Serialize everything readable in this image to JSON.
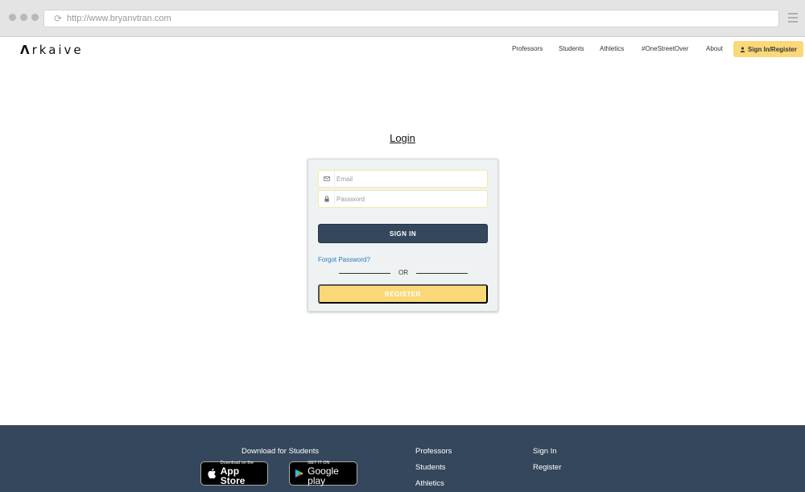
{
  "browser": {
    "url": "http://www.bryanvtran.com"
  },
  "navbar": {
    "logo_mark": "Λ",
    "logo_text": "rkaive",
    "links": [
      "Professors",
      "Students",
      "Athletics",
      "#OneStreetOver",
      "About"
    ],
    "signin_label": "Sign In/Register"
  },
  "login": {
    "title": "Login",
    "email_placeholder": "Email",
    "password_placeholder": "Password",
    "signin_button": "SIGN IN",
    "forgot_link": "Forgot Password?",
    "or_text": "OR",
    "register_button": "REGISTER"
  },
  "footer": {
    "download_heading": "Download for Students",
    "appstore": {
      "small": "Download on the",
      "big": "App Store"
    },
    "googleplay": {
      "small": "GET IT ON",
      "big": "Google play"
    },
    "col2": [
      "Professors",
      "Students",
      "Athletics"
    ],
    "col3": [
      "Sign In",
      "Register"
    ]
  },
  "colors": {
    "accent_yellow": "#fad879",
    "navy": "#34475c",
    "link_blue": "#2b7bbd"
  },
  "icons": {
    "reload": "reload-icon",
    "menu": "hamburger-menu-icon",
    "user": "user-icon",
    "envelope": "envelope-icon",
    "lock": "lock-icon",
    "apple": "apple-icon",
    "play": "google-play-icon"
  }
}
